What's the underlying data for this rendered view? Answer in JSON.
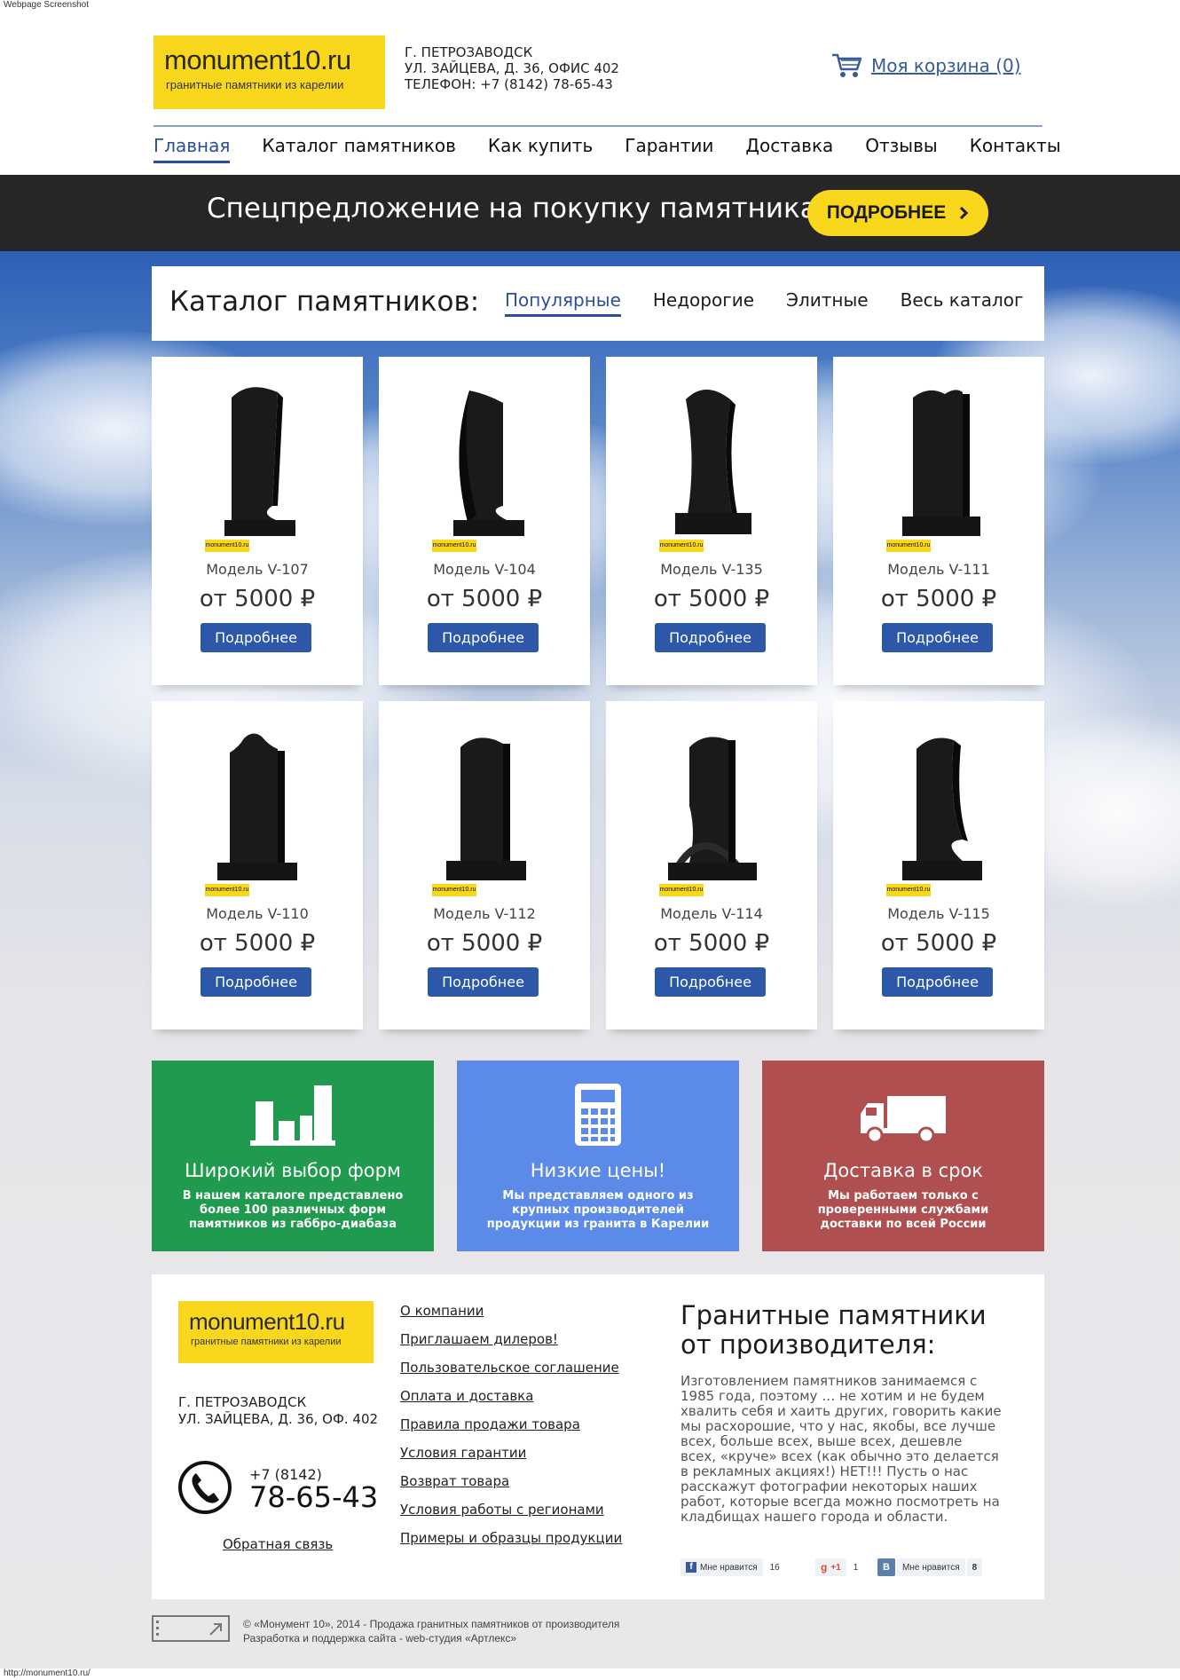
{
  "chrome": {
    "top_label": "Webpage Screenshot",
    "bottom_url": "http://monument10.ru/"
  },
  "brand": {
    "name": "monument10.ru",
    "tagline": "гранитные памятники из карелии",
    "yellow": "#f9d71c",
    "blue": "#2d58aa"
  },
  "header": {
    "address_line1": "Г. ПЕТРОЗАВОДСК",
    "address_line2": "УЛ. ЗАЙЦЕВА, Д. 36, ОФИС 402",
    "phone_line": "ТЕЛЕФОН: +7 (8142) 78-65-43",
    "cart_label": "Моя корзина (0)"
  },
  "nav": {
    "items": [
      {
        "label": "Главная"
      },
      {
        "label": "Каталог памятников"
      },
      {
        "label": "Как купить"
      },
      {
        "label": "Гарантии"
      },
      {
        "label": "Доставка"
      },
      {
        "label": "Отзывы"
      },
      {
        "label": "Контакты"
      }
    ],
    "active": "Главная"
  },
  "promo": {
    "text": "Спецпредложение на покупку памятника",
    "button": "ПОДРОБНЕЕ"
  },
  "catalog": {
    "title": "Каталог памятников:",
    "tabs": [
      {
        "label": "Популярные"
      },
      {
        "label": "Недорогие"
      },
      {
        "label": "Элитные"
      },
      {
        "label": "Весь каталог"
      }
    ],
    "active_tab": "Популярные",
    "watermark": "monument10.ru",
    "products": [
      {
        "model": "Модель V-107",
        "price": "от 5000 ₽",
        "button": "Подробнее"
      },
      {
        "model": "Модель V-104",
        "price": "от 5000 ₽",
        "button": "Подробнее"
      },
      {
        "model": "Модель V-135",
        "price": "от 5000 ₽",
        "button": "Подробнее"
      },
      {
        "model": "Модель V-111",
        "price": "от 5000 ₽",
        "button": "Подробнее"
      },
      {
        "model": "Модель V-110",
        "price": "от 5000 ₽",
        "button": "Подробнее"
      },
      {
        "model": "Модель V-112",
        "price": "от 5000 ₽",
        "button": "Подробнее"
      },
      {
        "model": "Модель V-114",
        "price": "от 5000 ₽",
        "button": "Подробнее"
      },
      {
        "model": "Модель V-115",
        "price": "от 5000 ₽",
        "button": "Подробнее"
      }
    ]
  },
  "features": [
    {
      "icon": "bar-chart-icon",
      "color": "#1f9a4e",
      "title": "Широкий выбор форм",
      "text": "В нашем каталоге представлено более 100 различных форм памятников из габбро-диабаза"
    },
    {
      "icon": "calculator-icon",
      "color": "#5b8ae8",
      "title": "Низкие цены!",
      "text": "Мы представляем одного из крупных производителей продукции из гранита в Карелии"
    },
    {
      "icon": "truck-icon",
      "color": "#b04f4f",
      "title": "Доставка в срок",
      "text": "Мы работаем только с проверенными службами доставки по всей России"
    }
  ],
  "footer": {
    "address_line1": "Г. ПЕТРОЗАВОДСК",
    "address_line2": "УЛ. ЗАЙЦЕВА, Д. 36, ОФ. 402",
    "phone_code": "+7 (8142)",
    "phone_number": "78-65-43",
    "feedback": "Обратная связь",
    "links": [
      {
        "label": "О компании"
      },
      {
        "label": "Приглашаем дилеров!"
      },
      {
        "label": "Пользовательское соглашение"
      },
      {
        "label": "Оплата и доставка"
      },
      {
        "label": "Правила продажи товара"
      },
      {
        "label": "Условия гарантии"
      },
      {
        "label": "Возврат товара"
      },
      {
        "label": "Условия работы с регионами"
      },
      {
        "label": "Примеры и образцы продукции"
      }
    ],
    "heading": "Гранитные памятники от производителя:",
    "paragraph": "Изготовлением памятников занимаемся с 1985 года, поэтому … не хотим и не будем хвалить себя и хаить других, говорить какие мы расхорошие, что у нас, якобы, все лучше всех, больше всех, выше всех, дешевле всех, «круче» всех (как обычно это делается в рекламных акциях!) НЕТ!!! Пусть о нас расскажут фотографии некоторых наших работ, которые всегда можно посмотреть на кладбищах нашего города и области.",
    "social": {
      "fb_label": "Мне нравится",
      "fb_count": "16",
      "gplus_label": "+1",
      "gplus_count": "1",
      "vk_label": "Мне нравится",
      "vk_count": "8"
    }
  },
  "copyright": {
    "line1": "© «Монумент 10», 2014 - Продажа гранитных памятников от производителя",
    "line2": "Разработка и поддержка сайта - web-студия «Артлекс»"
  }
}
